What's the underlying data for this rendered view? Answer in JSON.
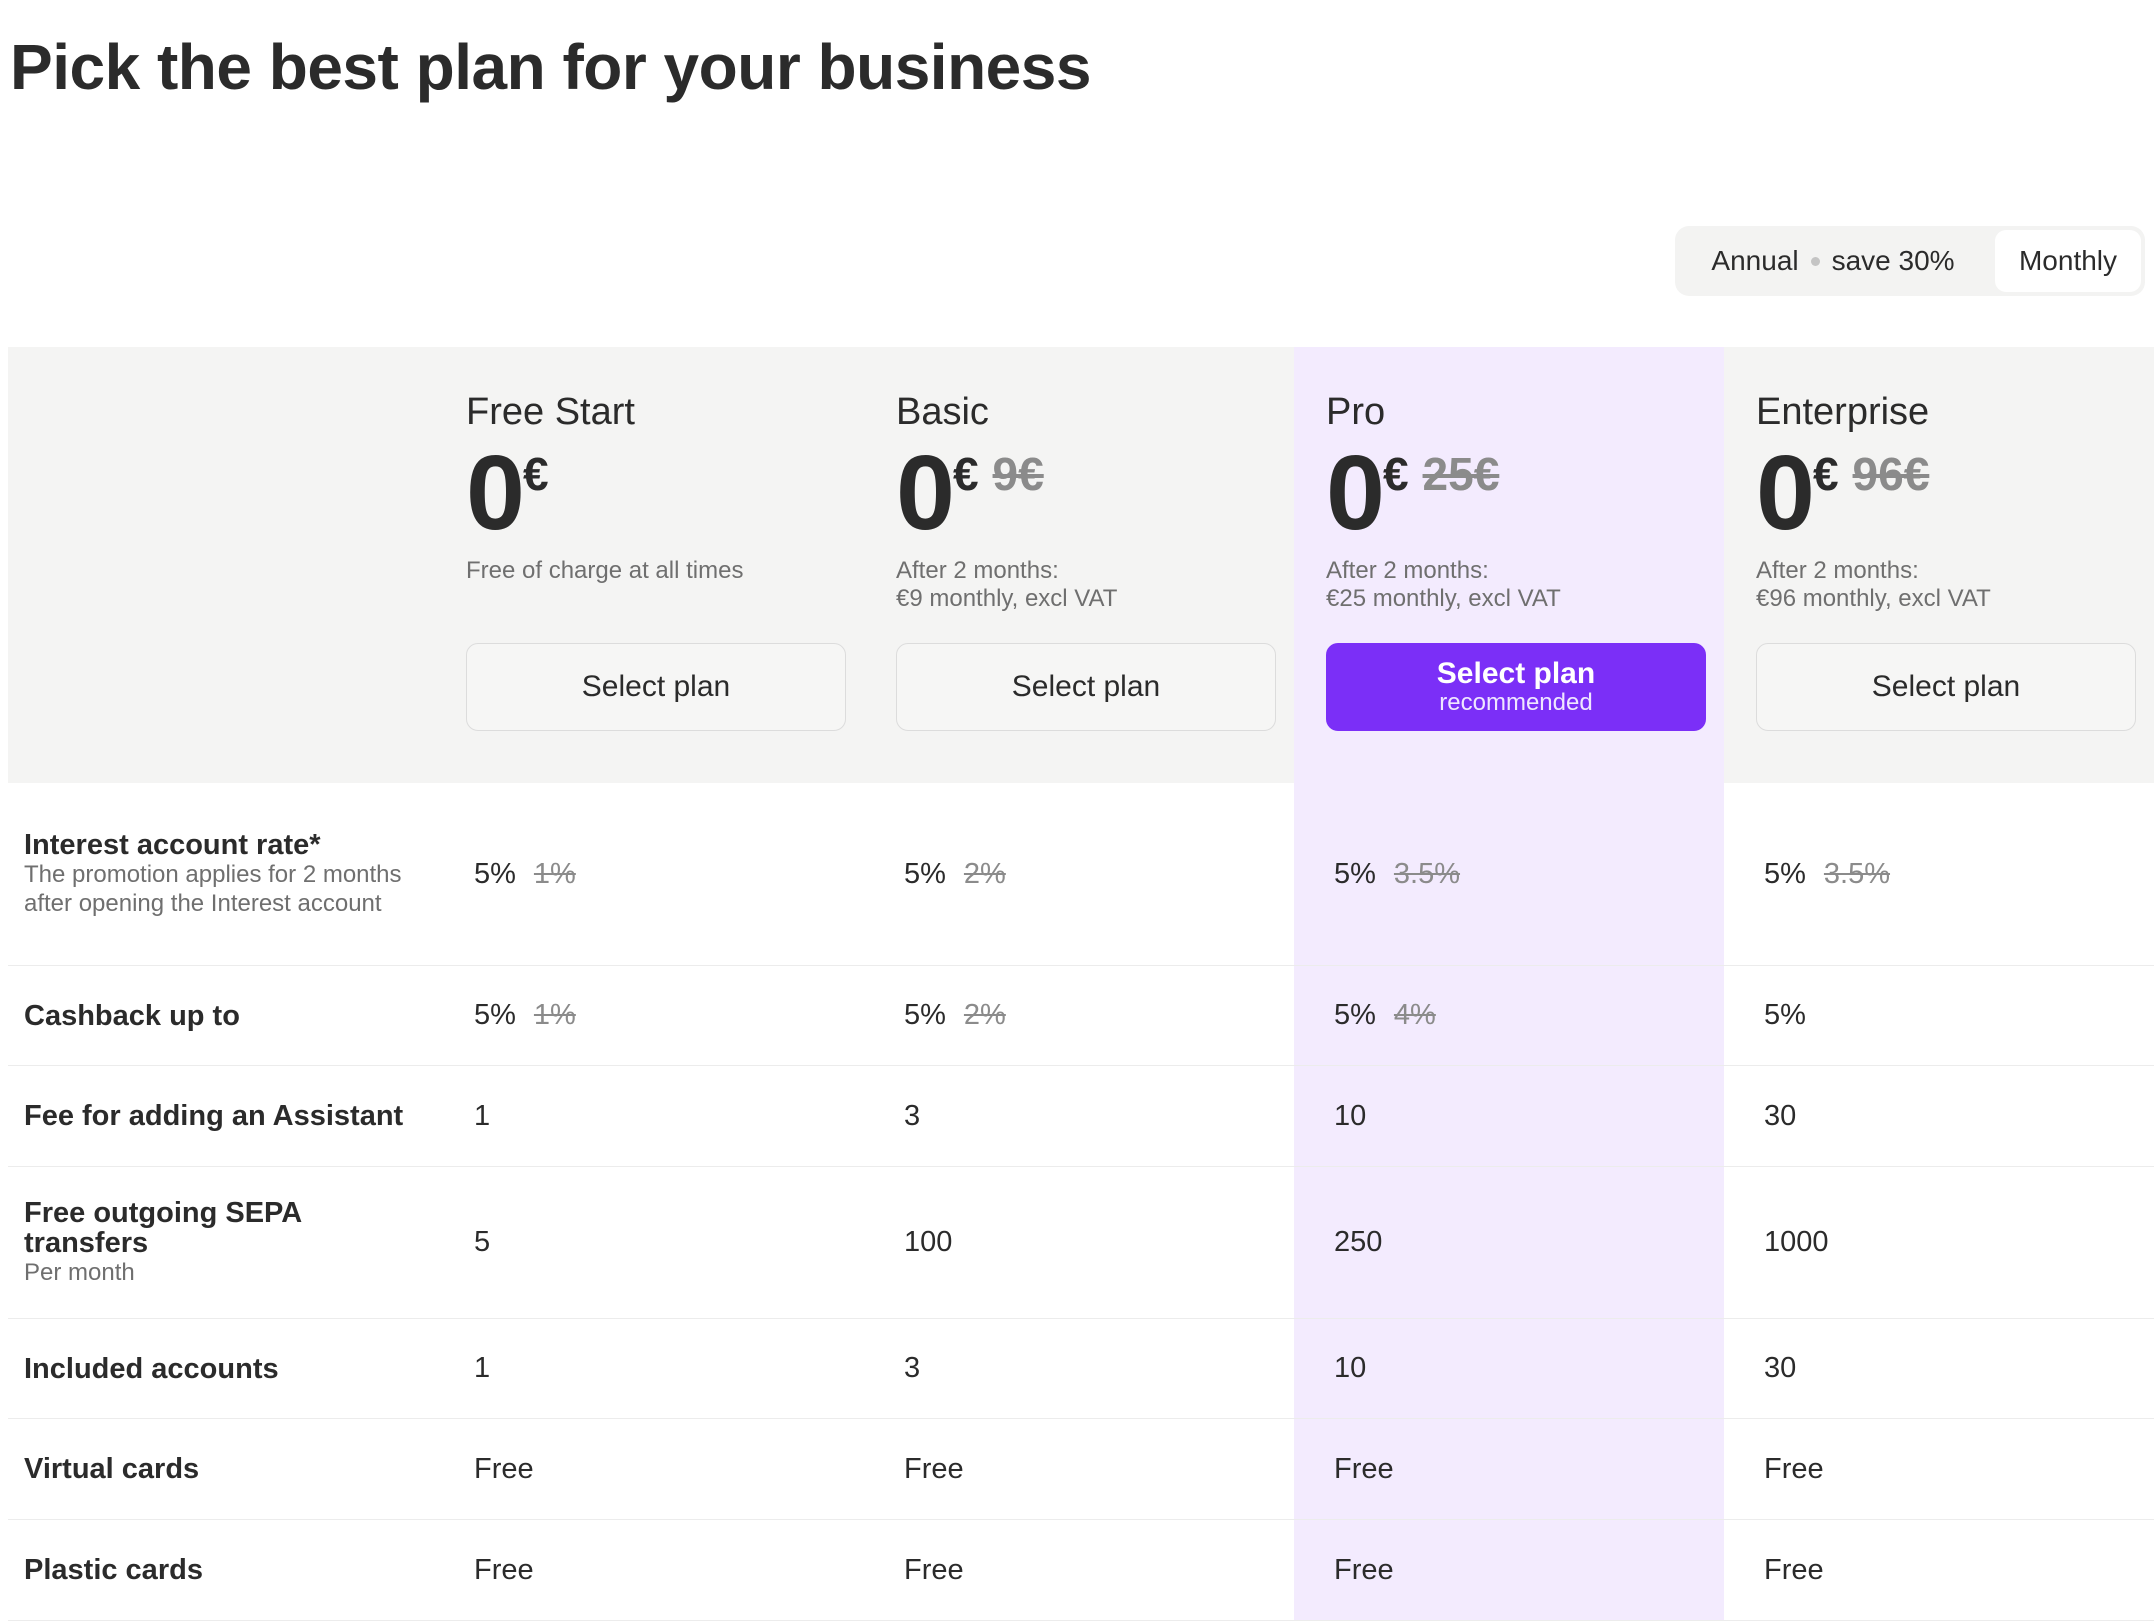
{
  "page": {
    "title": "Pick the best plan for your business"
  },
  "billing_toggle": {
    "annual_label": "Annual",
    "annual_discount": "save 30%",
    "monthly_label": "Monthly",
    "selected": "Monthly"
  },
  "colors": {
    "accent": "#7b2ff7",
    "highlight_column": "#f3ebfe",
    "header_background": "#f4f4f3"
  },
  "plans": [
    {
      "name": "Free Start",
      "price": "0",
      "currency": "€",
      "old_price": "",
      "description": "Free of charge at all times",
      "button_label": "Select plan",
      "button_sublabel": ""
    },
    {
      "name": "Basic",
      "price": "0",
      "currency": "€",
      "old_price": "9€",
      "description": "After 2 months:\n€9 monthly, excl VAT",
      "button_label": "Select plan",
      "button_sublabel": ""
    },
    {
      "name": "Pro",
      "price": "0",
      "currency": "€",
      "old_price": "25€",
      "description": "After 2 months:\n€25 monthly, excl VAT",
      "button_label": "Select plan",
      "button_sublabel": "recommended",
      "recommended": true
    },
    {
      "name": "Enterprise",
      "price": "0",
      "currency": "€",
      "old_price": "96€",
      "description": "After 2 months:\n€96 monthly, excl VAT",
      "button_label": "Select plan",
      "button_sublabel": ""
    }
  ],
  "features": [
    {
      "title": "Interest account rate*",
      "subtitle": "The promotion applies for 2 months after opening the Interest account",
      "values": [
        {
          "value": "5%",
          "old": "1%"
        },
        {
          "value": "5%",
          "old": "2%"
        },
        {
          "value": "5%",
          "old": "3.5%"
        },
        {
          "value": "5%",
          "old": "3.5%"
        }
      ]
    },
    {
      "title": "Cashback up to",
      "subtitle": "",
      "values": [
        {
          "value": "5%",
          "old": "1%"
        },
        {
          "value": "5%",
          "old": "2%"
        },
        {
          "value": "5%",
          "old": "4%"
        },
        {
          "value": "5%",
          "old": ""
        }
      ]
    },
    {
      "title": "Fee for adding an Assistant",
      "subtitle": "",
      "values": [
        {
          "value": "1",
          "old": ""
        },
        {
          "value": "3",
          "old": ""
        },
        {
          "value": "10",
          "old": ""
        },
        {
          "value": "30",
          "old": ""
        }
      ]
    },
    {
      "title": "Free outgoing SEPA transfers",
      "subtitle": "Per month",
      "values": [
        {
          "value": "5",
          "old": ""
        },
        {
          "value": "100",
          "old": ""
        },
        {
          "value": "250",
          "old": ""
        },
        {
          "value": "1000",
          "old": ""
        }
      ]
    },
    {
      "title": "Included accounts",
      "subtitle": "",
      "values": [
        {
          "value": "1",
          "old": ""
        },
        {
          "value": "3",
          "old": ""
        },
        {
          "value": "10",
          "old": ""
        },
        {
          "value": "30",
          "old": ""
        }
      ]
    },
    {
      "title": "Virtual cards",
      "subtitle": "",
      "values": [
        {
          "value": "Free",
          "old": ""
        },
        {
          "value": "Free",
          "old": ""
        },
        {
          "value": "Free",
          "old": ""
        },
        {
          "value": "Free",
          "old": ""
        }
      ]
    },
    {
      "title": "Plastic cards",
      "subtitle": "",
      "values": [
        {
          "value": "Free",
          "old": ""
        },
        {
          "value": "Free",
          "old": ""
        },
        {
          "value": "Free",
          "old": ""
        },
        {
          "value": "Free",
          "old": ""
        }
      ]
    }
  ]
}
